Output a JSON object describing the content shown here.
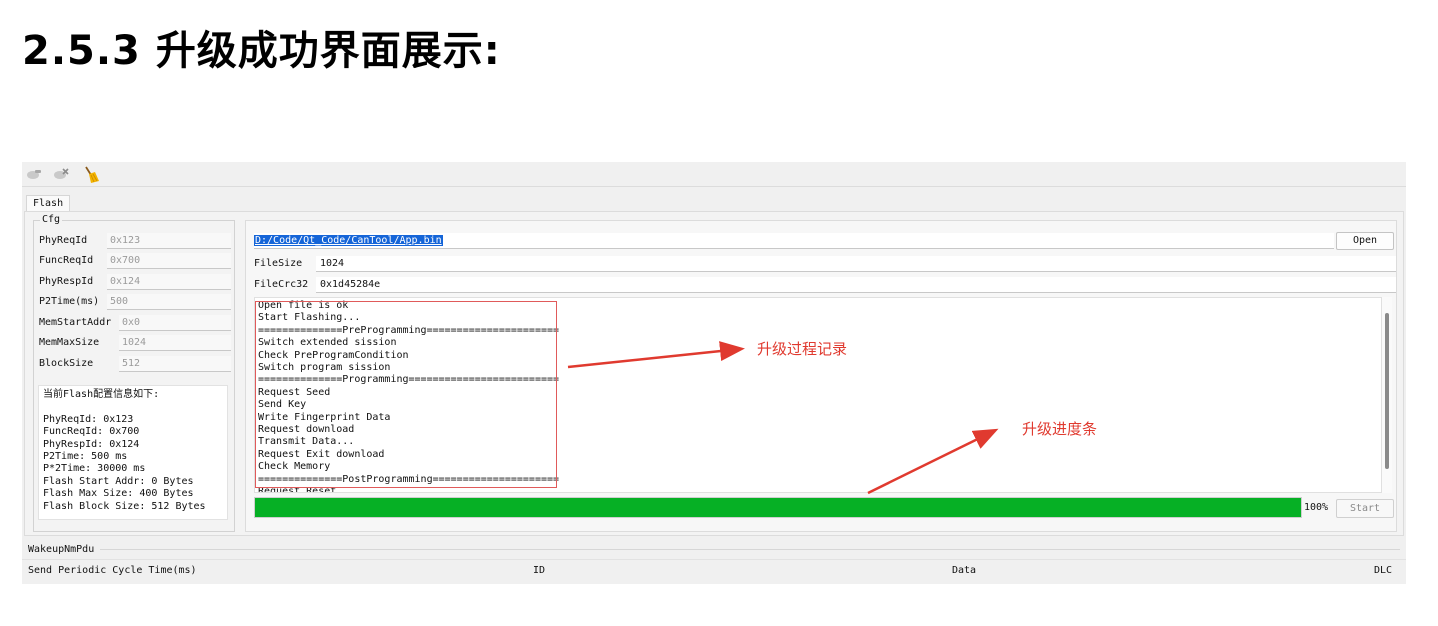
{
  "document": {
    "heading": "2.5.3 升级成功界面展示:"
  },
  "toolbar": {
    "icons": [
      "connect-icon",
      "disconnect-icon",
      "broom-icon"
    ]
  },
  "tabs": [
    {
      "label": "Flash"
    }
  ],
  "cfg": {
    "title": "Cfg",
    "fields": [
      {
        "label": "PhyReqId",
        "value": "0x123"
      },
      {
        "label": "FuncReqId",
        "value": "0x700"
      },
      {
        "label": "PhyRespId",
        "value": "0x124"
      },
      {
        "label": "P2Time(ms)",
        "value": "500"
      },
      {
        "label": "MemStartAddr",
        "value": "0x0"
      },
      {
        "label": "MemMaxSize",
        "value": "1024"
      },
      {
        "label": "BlockSize",
        "value": "512"
      }
    ],
    "info_text": "当前Flash配置信息如下:\n\nPhyReqId: 0x123\nFuncReqId: 0x700\nPhyRespId: 0x124\nP2Time: 500 ms\nP*2Time: 30000 ms\nFlash Start Addr: 0 Bytes\nFlash Max Size: 400 Bytes\nFlash Block Size: 512 Bytes"
  },
  "file": {
    "path": "D:/Code/Qt_Code/CanTool/App.bin",
    "open_label": "Open",
    "size_label": "FileSize",
    "size_value": "1024",
    "crc_label": "FileCrc32",
    "crc_value": "0x1d45284e"
  },
  "log": {
    "lines": "Open file is ok\nStart Flashing...\n==============PreProgramming======================\nSwitch extended sission\nCheck PreProgramCondition\nSwitch program sission\n==============Programming=========================\nRequest Seed\nSend Key\nWrite Fingerprint Data\nRequest download\nTransmit Data...\nRequest Exit download\nCheck Memory\n==============PostProgramming=====================\nRequest Reset"
  },
  "progress": {
    "value": 1.0,
    "label": "100%",
    "start_label": "Start",
    "fill_color": "#06b025"
  },
  "annotations": {
    "log_label": "升级过程记录",
    "progress_label": "升级进度条",
    "color": "#e03a2f"
  },
  "wakeup": {
    "title": "WakeupNmPdu",
    "columns": [
      "Send Periodic Cycle Time(ms)",
      "ID",
      "Data",
      "DLC"
    ]
  }
}
